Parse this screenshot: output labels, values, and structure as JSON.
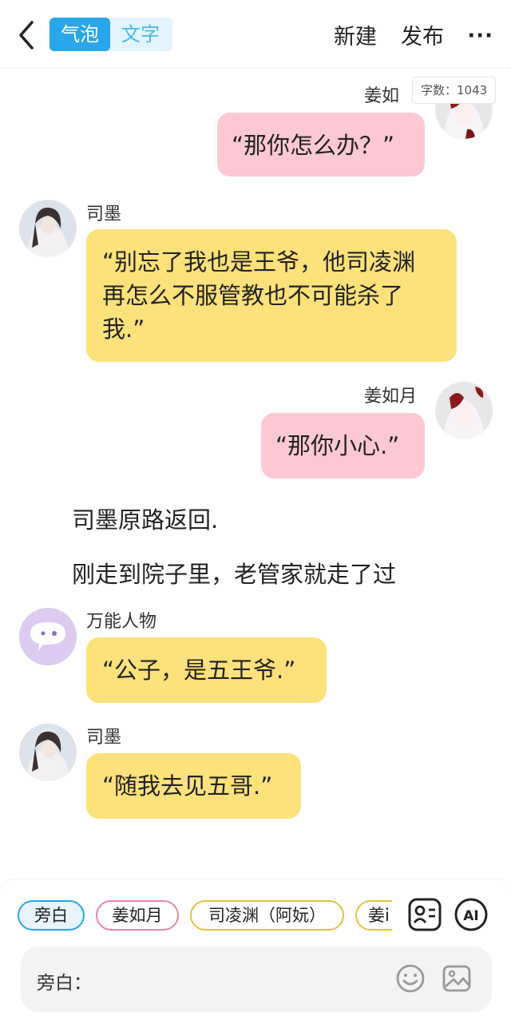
{
  "topbar": {
    "mode_tabs": [
      "气泡",
      "文字"
    ],
    "new_label": "新建",
    "publish_label": "发布",
    "more_label": "···"
  },
  "word_count": "字数：1043",
  "messages": [
    {
      "speaker": "姜如月",
      "side": "right",
      "text": "“那你怎么办？”",
      "color": "pink"
    },
    {
      "speaker": "司墨",
      "side": "left",
      "text": "“别忘了我也是王爷，他司凌渊再怎么不服管教也不可能杀了我.”",
      "color": "yellow"
    },
    {
      "speaker": "姜如月",
      "side": "right",
      "text": "“那你小心.”",
      "color": "pink"
    },
    {
      "speaker": "司墨",
      "side": "left",
      "text": "“公子，是五王爷.”",
      "color": "yellow"
    },
    {
      "speaker": "万能人物",
      "side": "left",
      "text": "“公子，是五王爷.”",
      "color": "yellow"
    },
    {
      "speaker": "司墨",
      "side": "left",
      "text": "“随我去见五哥.”",
      "color": "yellow"
    }
  ],
  "chat": {
    "m1_name": "姜如",
    "m1_text": "“那你怎么办？”",
    "m2_name": "司墨",
    "m2_line1": "“别忘了我也是王爷，他司凌渊",
    "m2_line2": "再怎么不服管教也不可能杀了",
    "m2_line3": "我.”",
    "m3_name": "姜如月",
    "m3_text": "“那你小心.”",
    "narration1": "司墨原路返回.",
    "narration2": "刚走到院子里，老管家就走了过",
    "m4_name": "万能人物",
    "m4_text": "“公子，是五王爷.”",
    "m5_name": "司墨",
    "m5_text": "“随我去见五哥.”"
  },
  "roles": [
    {
      "label": "旁白",
      "color": "#2aa6ea",
      "selected": true
    },
    {
      "label": "姜如月",
      "color": "#e08aa3",
      "selected": false
    },
    {
      "label": "司凌渊（阿妧）",
      "color": "#e2c33a",
      "selected": false
    },
    {
      "label": "姜i",
      "color": "#e2c33a",
      "selected": false
    }
  ],
  "input": {
    "label": "旁白：",
    "placeholder": ""
  },
  "icons": [
    "back-arrow-icon",
    "role-card-icon",
    "ai-icon",
    "emoji-icon",
    "image-icon",
    "more-dots-icon"
  ],
  "colors": {
    "accent": "#2aa6ea",
    "pink_bubble": "#fcc8d4",
    "yellow_bubble": "#fde17a"
  }
}
